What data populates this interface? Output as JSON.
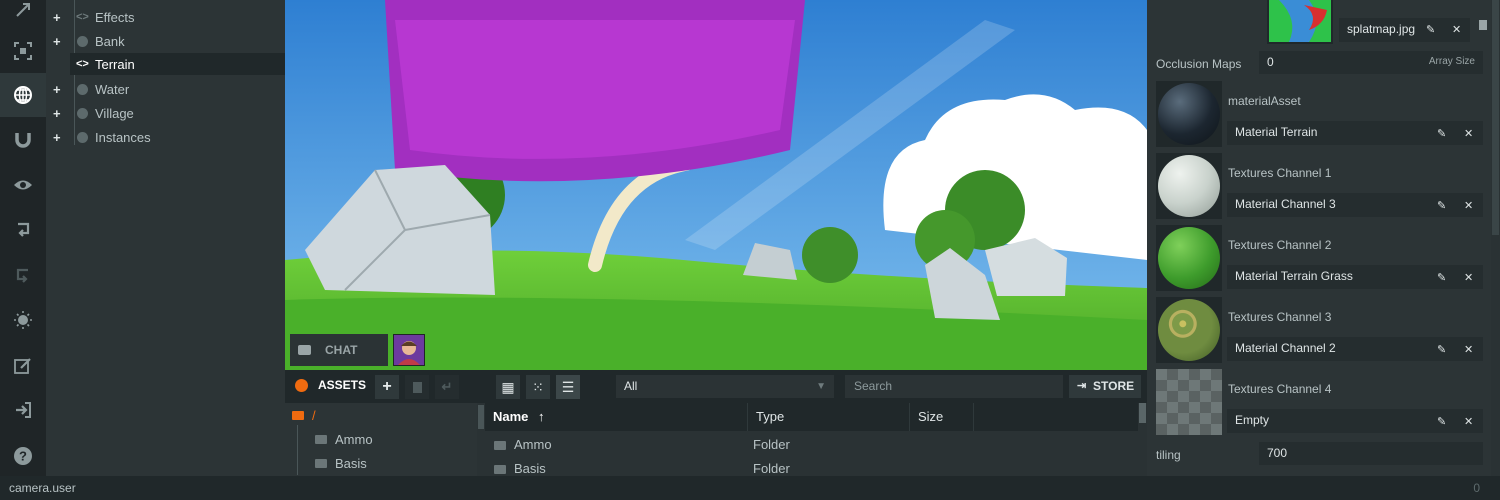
{
  "toolbar": {
    "items": [
      {
        "icon": "expand-icon"
      },
      {
        "icon": "focus-frame-icon"
      },
      {
        "icon": "globe-icon",
        "active": true
      },
      {
        "icon": "magnet-icon"
      },
      {
        "icon": "eye-icon"
      },
      {
        "icon": "undo-icon"
      },
      {
        "icon": "redo-icon"
      },
      {
        "icon": "lightbulb-icon"
      },
      {
        "icon": "edit-icon"
      },
      {
        "icon": "publish-icon"
      },
      {
        "icon": "help-icon"
      }
    ]
  },
  "hierarchy": {
    "items": [
      {
        "label": "Effects",
        "expandable": true
      },
      {
        "label": "Bank",
        "expandable": true
      },
      {
        "label": "Terrain",
        "selected": true
      },
      {
        "label": "Water",
        "expandable": true
      },
      {
        "label": "Village",
        "expandable": true
      },
      {
        "label": "Instances",
        "expandable": true
      }
    ]
  },
  "viewport": {
    "chat_label": "CHAT"
  },
  "assets": {
    "title": "ASSETS",
    "add_label": "+",
    "filter_value": "All",
    "search_placeholder": "Search",
    "store_label": "STORE",
    "tree": [
      {
        "label": "/",
        "root": true
      },
      {
        "label": "Ammo"
      },
      {
        "label": "Basis"
      }
    ],
    "columns": [
      "Name",
      "Type",
      "Size"
    ],
    "rows": [
      {
        "name": "Ammo",
        "type": "Folder",
        "size": ""
      },
      {
        "name": "Basis",
        "type": "Folder",
        "size": ""
      }
    ]
  },
  "inspector": {
    "splatmap_name": "splatmap.jpg",
    "occlusion_label": "Occlusion Maps",
    "occlusion_value": "0",
    "occlusion_suffix": "Array Size",
    "slots": [
      {
        "label": "materialAsset",
        "value": "Material Terrain",
        "color": "#1c2630"
      },
      {
        "label": "Textures Channel 1",
        "value": "Material Channel 3",
        "color": "#c9d2cc"
      },
      {
        "label": "Textures Channel 2",
        "value": "Material Terrain Grass",
        "color": "#3e9c2c"
      },
      {
        "label": "Textures Channel 3",
        "value": "Material Channel 2",
        "color": "#7e9a48"
      },
      {
        "label": "Textures Channel 4",
        "value": "Empty",
        "color": "#5a6262"
      }
    ],
    "tiling_label": "tiling",
    "tiling_value": "700"
  },
  "status": {
    "text": "camera.user",
    "count": "0"
  },
  "colors": {
    "accent": "#f06b10",
    "panel": "#2c3436",
    "dark": "#20282a"
  }
}
